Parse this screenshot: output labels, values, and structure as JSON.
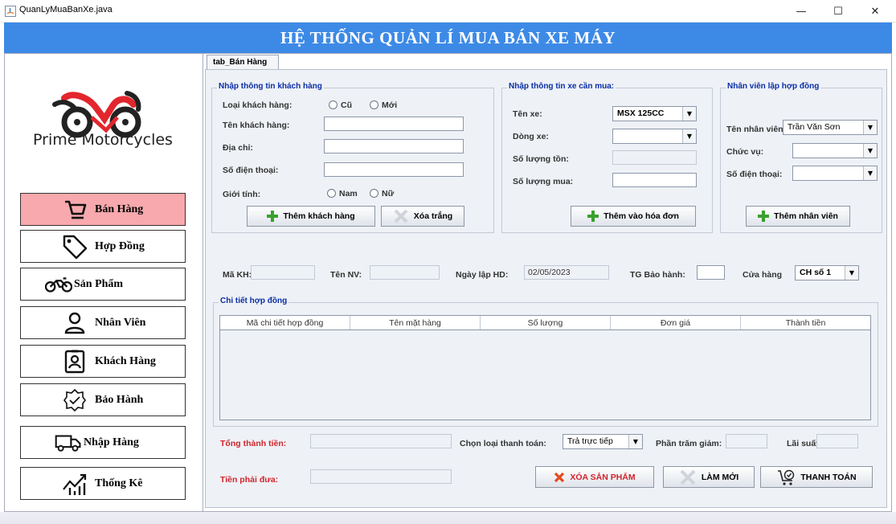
{
  "window": {
    "title": "QuanLyMuaBanXe.java",
    "minimize": "—",
    "maximize": "☐",
    "close": "✕"
  },
  "banner": {
    "title": "HỆ THỐNG QUẢN LÍ MUA BÁN XE MÁY"
  },
  "brand": {
    "logo_text": "Prime Motorcycles",
    "accent": "#e3262d"
  },
  "nav": {
    "items": [
      {
        "label": "Bán Hàng",
        "icon": "cart-icon"
      },
      {
        "label": "Hợp Đồng",
        "icon": "tag-icon"
      },
      {
        "label": "Sản Phẩm",
        "icon": "motorbike-icon"
      },
      {
        "label": "Nhân Viên",
        "icon": "user-icon"
      },
      {
        "label": "Khách Hàng",
        "icon": "id-card-icon"
      },
      {
        "label": "Bảo Hành",
        "icon": "badge-check-icon"
      },
      {
        "label": "Nhập Hàng",
        "icon": "truck-icon"
      },
      {
        "label": "Thống Kê",
        "icon": "chart-icon"
      }
    ]
  },
  "tab": {
    "label": "tab_Bán Hàng"
  },
  "customer": {
    "group_title": "Nhập thông tin khách hàng",
    "type_label": "Loại khách hàng:",
    "type_old": "Cũ",
    "type_new": "Mới",
    "name_label": "Tên khách hàng:",
    "address_label": "Địa chỉ:",
    "phone_label": "Số điện thoại:",
    "gender_label": "Giới tính:",
    "gender_male": "Nam",
    "gender_female": "Nữ",
    "add_button": "Thêm khách hàng",
    "clear_button": "Xóa trắng"
  },
  "vehicle": {
    "group_title": "Nhập thông tin xe cần mua:",
    "name_label": "Tên xe:",
    "name_value": "MSX 125CC",
    "line_label": "Dòng xe:",
    "stock_label": "Số lượng tồn:",
    "qty_label": "Số lượng mua:",
    "add_button": "Thêm vào hóa đơn"
  },
  "staff": {
    "group_title": "Nhân viên lập hợp đồng",
    "name_label": "Tên nhân viên:",
    "name_value": "Trần Văn Sơn",
    "role_label": "Chức vụ:",
    "phone_label": "Số điện thoại:",
    "add_button": "Thêm nhân viên"
  },
  "info_row": {
    "customer_id_label": "Mã KH:",
    "staff_name_label": "Tên NV:",
    "date_label": "Ngày lập HD:",
    "date_value": "02/05/2023",
    "warranty_label": "TG Bảo hành:",
    "store_label": "Cửa hàng",
    "store_value": "CH số 1"
  },
  "details": {
    "group_title": "Chi tiết hợp đồng",
    "columns": [
      "Mã chi tiết hợp đồng",
      "Tên mặt hàng",
      "Số lượng",
      "Đơn giá",
      "Thành tiền"
    ]
  },
  "payment": {
    "total_label": "Tổng thành tiền:",
    "method_label": "Chọn loại thanh toán:",
    "method_value": "Trả trực tiếp",
    "discount_label": "Phần trăm giảm:",
    "interest_label": "Lãi suất:",
    "due_label": "Tiền phải đưa:",
    "delete_button": "XÓA SẢN PHẨM",
    "refresh_button": "LÀM MỚI",
    "pay_button": "THANH TOÁN"
  }
}
